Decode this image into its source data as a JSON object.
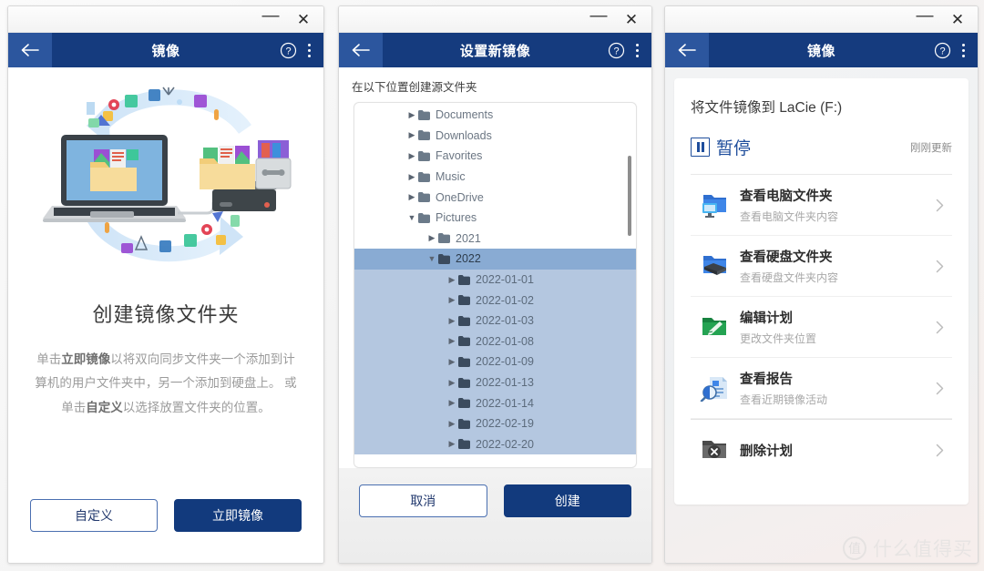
{
  "colors": {
    "appbar_navy": "#153b7e",
    "back_btn": "#2c569e",
    "primary_btn": "#123a7d",
    "outline_btn_border": "#4a6fb0",
    "tree_selected": "#89abd3",
    "tree_child": "#b4c7e0",
    "status_blue": "#1f4e9c"
  },
  "window_controls": {
    "minimize": "—",
    "close": "✕"
  },
  "panel1": {
    "title": "镜像",
    "back_icon": "back-arrow-icon",
    "help_icon": "help-circle-icon",
    "more_icon": "more-vertical-icon",
    "illustration": "sync-laptop-harddrive-illustration",
    "heading": "创建镜像文件夹",
    "description_parts": [
      {
        "text": "单击",
        "bold": false
      },
      {
        "text": "立即镜像",
        "bold": true
      },
      {
        "text": "以将双向同步文件夹一个添加到计算机的用户文件夹中，另一个添加到硬盘上。 或单击",
        "bold": false
      },
      {
        "text": "自定义",
        "bold": true
      },
      {
        "text": "以选择放置文件夹的位置。",
        "bold": false
      }
    ],
    "buttons": {
      "secondary": "自定义",
      "primary": "立即镜像"
    }
  },
  "panel2": {
    "title": "设置新镜像",
    "back_icon": "back-arrow-icon",
    "help_icon": "help-circle-icon",
    "more_icon": "more-vertical-icon",
    "subtitle": "在以下位置创建源文件夹",
    "tree": [
      {
        "label": "Documents",
        "indent": 0,
        "state": "collapsed",
        "selected": false
      },
      {
        "label": "Downloads",
        "indent": 0,
        "state": "collapsed",
        "selected": false
      },
      {
        "label": "Favorites",
        "indent": 0,
        "state": "collapsed",
        "selected": false
      },
      {
        "label": "Music",
        "indent": 0,
        "state": "collapsed",
        "selected": false
      },
      {
        "label": "OneDrive",
        "indent": 0,
        "state": "collapsed",
        "selected": false
      },
      {
        "label": "Pictures",
        "indent": 0,
        "state": "expanded",
        "selected": false
      },
      {
        "label": "2021",
        "indent": 1,
        "state": "collapsed",
        "selected": false
      },
      {
        "label": "2022",
        "indent": 1,
        "state": "expanded",
        "selected": true
      },
      {
        "label": "2022-01-01",
        "indent": 2,
        "state": "collapsed",
        "child": true
      },
      {
        "label": "2022-01-02",
        "indent": 2,
        "state": "collapsed",
        "child": true
      },
      {
        "label": "2022-01-03",
        "indent": 2,
        "state": "collapsed",
        "child": true
      },
      {
        "label": "2022-01-08",
        "indent": 2,
        "state": "collapsed",
        "child": true
      },
      {
        "label": "2022-01-09",
        "indent": 2,
        "state": "collapsed",
        "child": true
      },
      {
        "label": "2022-01-13",
        "indent": 2,
        "state": "collapsed",
        "child": true
      },
      {
        "label": "2022-01-14",
        "indent": 2,
        "state": "collapsed",
        "child": true
      },
      {
        "label": "2022-02-19",
        "indent": 2,
        "state": "collapsed",
        "child": true
      },
      {
        "label": "2022-02-20",
        "indent": 2,
        "state": "collapsed",
        "child": true
      }
    ],
    "buttons": {
      "secondary": "取消",
      "primary": "创建"
    }
  },
  "panel3": {
    "title": "镜像",
    "back_icon": "back-arrow-icon",
    "help_icon": "help-circle-icon",
    "more_icon": "more-vertical-icon",
    "destination": "将文件镜像到 LaCie (F:)",
    "pause_label": "暂停",
    "pause_icon": "pause-icon",
    "updated_text": "刚刚更新",
    "items": [
      {
        "title": "查看电脑文件夹",
        "subtitle": "查看电脑文件夹内容",
        "icon": "folder-computer-icon",
        "separator_above": false
      },
      {
        "title": "查看硬盘文件夹",
        "subtitle": "查看硬盘文件夹内容",
        "icon": "folder-harddrive-icon",
        "separator_above": false
      },
      {
        "title": "编辑计划",
        "subtitle": "更改文件夹位置",
        "icon": "folder-edit-icon",
        "separator_above": false
      },
      {
        "title": "查看报告",
        "subtitle": "查看近期镜像活动",
        "icon": "report-search-icon",
        "separator_above": false
      },
      {
        "title": "删除计划",
        "subtitle": "",
        "icon": "folder-delete-icon",
        "separator_above": true
      }
    ],
    "chevron_icon": "chevron-right-icon"
  },
  "watermark": {
    "badge": "值",
    "text": "什么值得买"
  }
}
